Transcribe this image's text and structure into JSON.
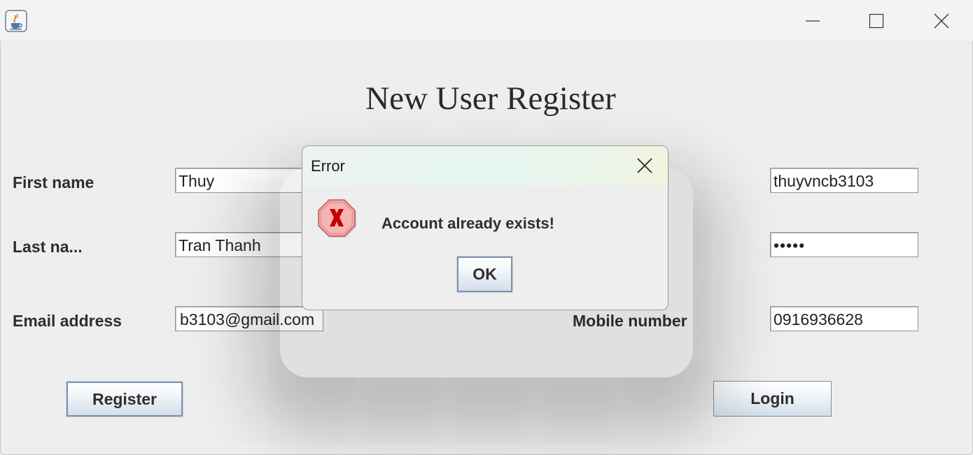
{
  "window": {
    "app_icon": "java-cup-icon",
    "controls": [
      "minimize-icon",
      "maximize-icon",
      "close-icon"
    ]
  },
  "form": {
    "heading": "New User Register",
    "first_name": {
      "label": "First name",
      "value": "Thuy"
    },
    "last_name": {
      "label": "Last na...",
      "value": "Tran Thanh"
    },
    "email": {
      "label": "Email address",
      "value": "b3103@gmail.com"
    },
    "username": {
      "value": "thuyvncb3103"
    },
    "password": {
      "value": "•••••"
    },
    "mobile": {
      "label": "Mobile number",
      "value": "0916936628"
    },
    "register_label": "Register",
    "login_label": "Login"
  },
  "dialog": {
    "title": "Error",
    "message": "Account already exists!",
    "ok_label": "OK",
    "icon": "error-x-icon",
    "colors": {
      "error_fill": "#f4a3a3",
      "error_x": "#c40000"
    }
  }
}
